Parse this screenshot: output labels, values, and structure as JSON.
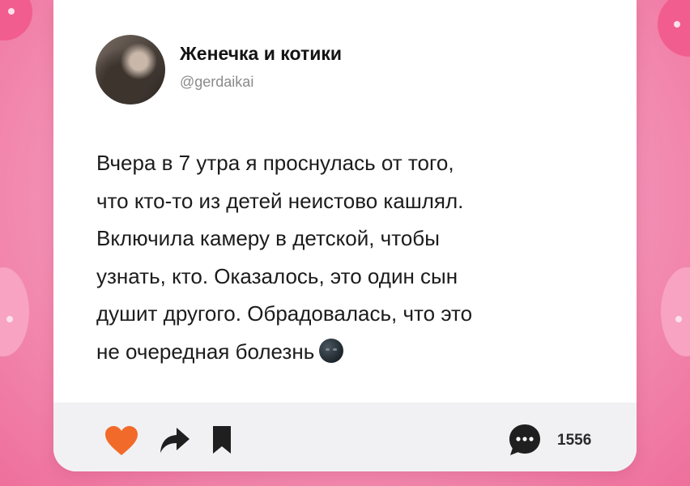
{
  "post": {
    "author_name": "Женечка и котики",
    "author_handle": "@gerdaikai",
    "text": "Вчера в 7 утра я проснулась от того,\nчто кто-то из детей неистово кашлял.\nВключила камеру в детской, чтобы\nузнать, кто. Оказалось, это один сын\nдушит другого. Обрадовалась, что это\nне очередная болезнь",
    "emoji": "new-moon-face-emoji"
  },
  "actions": {
    "like_icon": "heart-icon",
    "share_icon": "share-arrow-icon",
    "save_icon": "bookmark-icon",
    "comment_icon": "comment-bubble-icon",
    "comment_count": "1556"
  },
  "colors": {
    "background": "#f27fa6",
    "accent_heart": "#f26a2a",
    "icon_dark": "#1f1f1f",
    "action_bar": "#f1f1f3"
  }
}
